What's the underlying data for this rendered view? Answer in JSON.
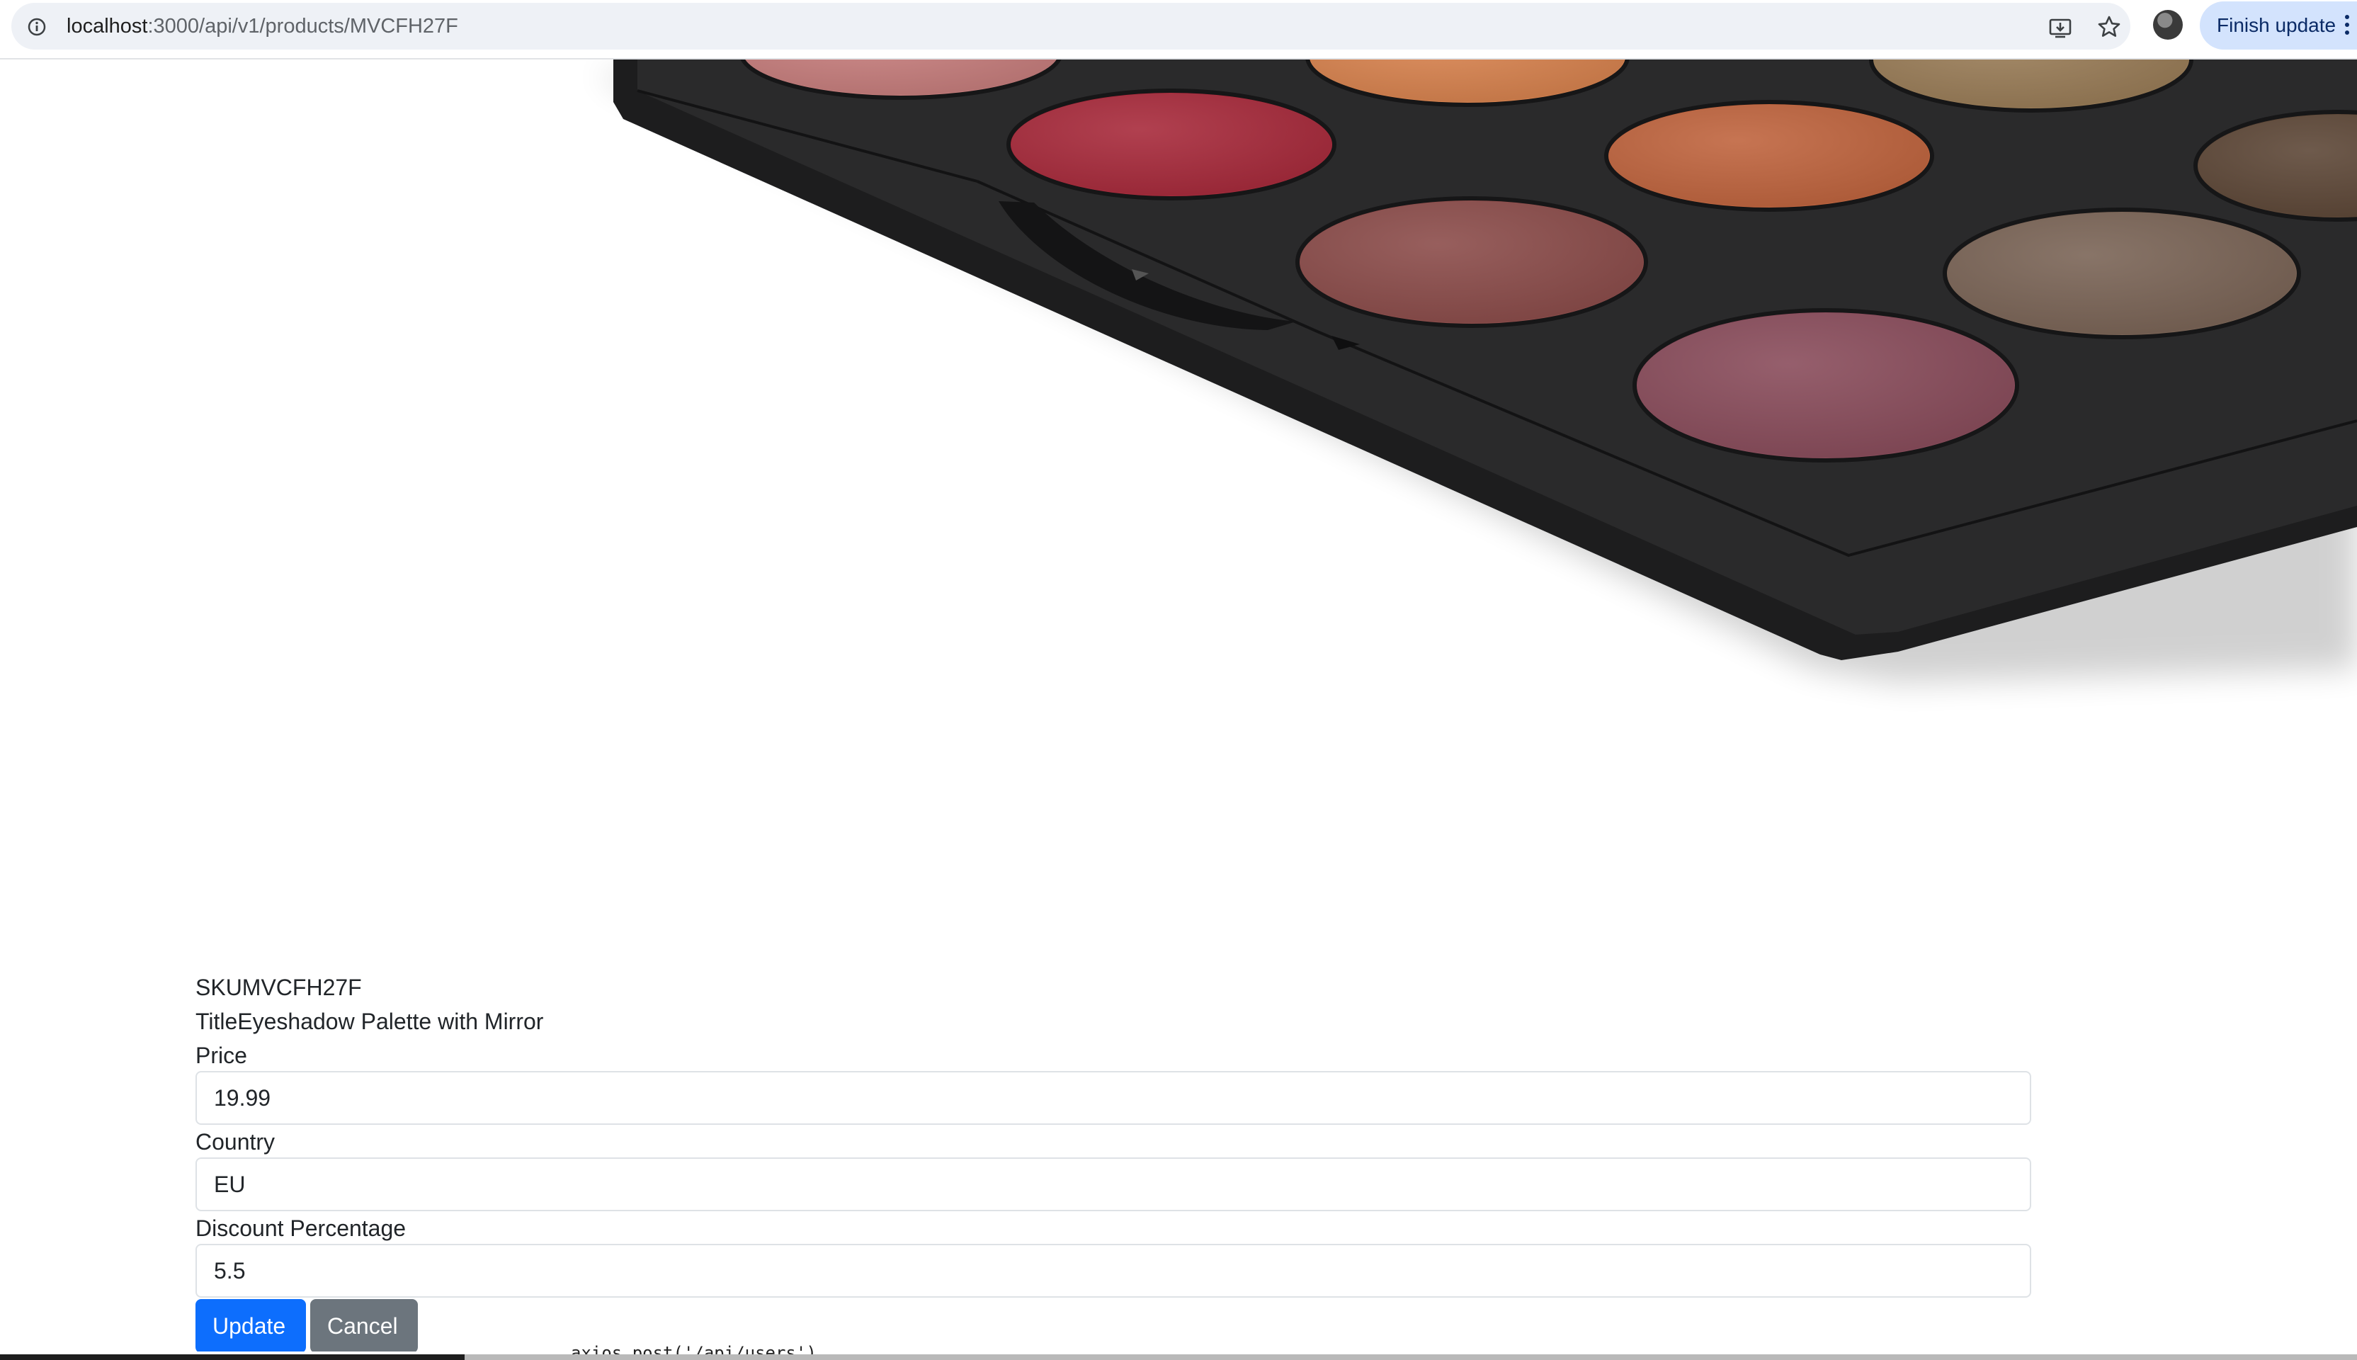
{
  "browser": {
    "url_host": "localhost",
    "url_path": ":3000/api/v1/products/MVCFH27F",
    "finish_update_label": "Finish update"
  },
  "product_image": {
    "subject": "eyeshadow palette",
    "shade_colors": [
      "#c77e7d",
      "#d8834f",
      "#9a7d58",
      "#a82b3c",
      "#c0653f",
      "#5e4838",
      "#8c4d4b",
      "#7b6557",
      "#8a4d5c"
    ]
  },
  "form": {
    "sku_text": "SKUMVCFH27F",
    "title_text": "TitleEyeshadow Palette with Mirror",
    "price_label": "Price",
    "price_value": "19.99",
    "country_label": "Country",
    "country_value": "EU",
    "discount_label": "Discount Percentage",
    "discount_value": "5.5",
    "update_label": "Update",
    "cancel_label": "Cancel"
  },
  "code_peek_text": "axios.post('/api/users')",
  "colors": {
    "primary": "#0d6efd",
    "secondary": "#6c757d",
    "finish_update_bg": "#d3e3fd"
  }
}
